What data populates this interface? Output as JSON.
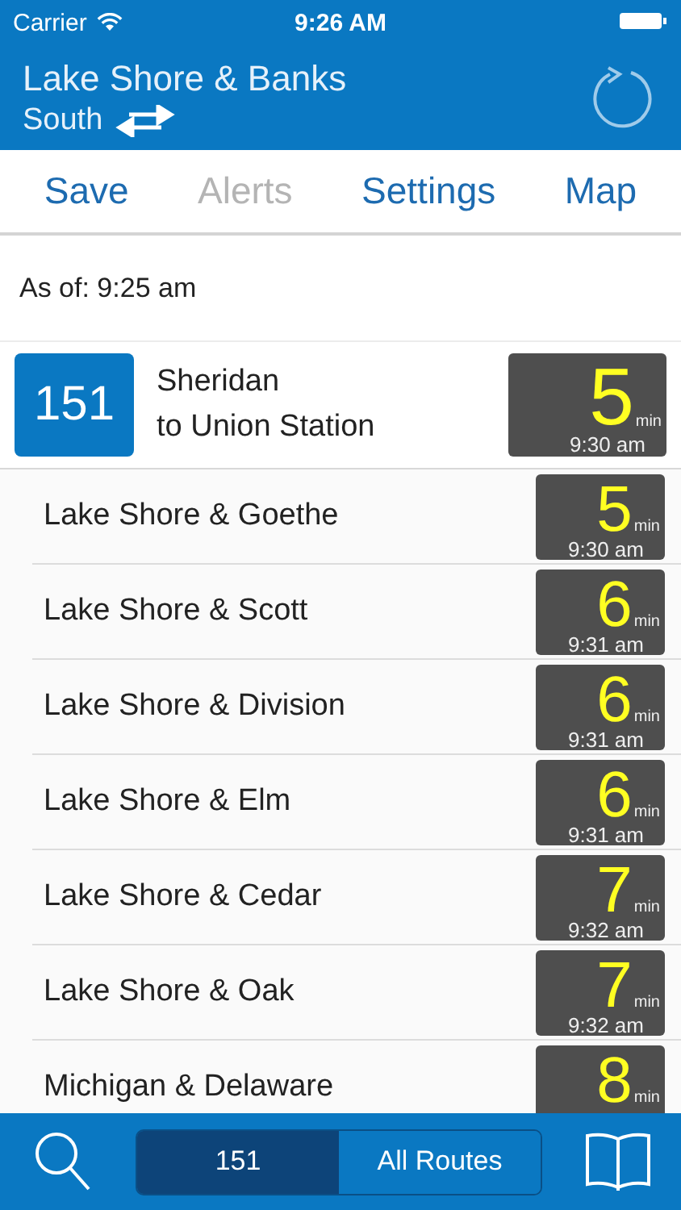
{
  "status_bar": {
    "carrier": "Carrier",
    "time": "9:26 AM"
  },
  "header": {
    "title": "Lake Shore & Banks",
    "direction": "South"
  },
  "actions": [
    {
      "label": "Save",
      "disabled": false
    },
    {
      "label": "Alerts",
      "disabled": true
    },
    {
      "label": "Settings",
      "disabled": false
    },
    {
      "label": "Map",
      "disabled": false
    }
  ],
  "as_of": "As of: 9:25 am",
  "route": {
    "number": "151",
    "name": "Sheridan",
    "destination": "to Union Station",
    "minutes": "5",
    "unit": "min",
    "time": "9:30 am"
  },
  "stops": [
    {
      "name": "Lake Shore & Goethe",
      "minutes": "5",
      "unit": "min",
      "time": "9:30 am"
    },
    {
      "name": "Lake Shore & Scott",
      "minutes": "6",
      "unit": "min",
      "time": "9:31 am"
    },
    {
      "name": "Lake Shore & Division",
      "minutes": "6",
      "unit": "min",
      "time": "9:31 am"
    },
    {
      "name": "Lake Shore & Elm",
      "minutes": "6",
      "unit": "min",
      "time": "9:31 am"
    },
    {
      "name": "Lake Shore & Cedar",
      "minutes": "7",
      "unit": "min",
      "time": "9:32 am"
    },
    {
      "name": "Lake Shore & Oak",
      "minutes": "7",
      "unit": "min",
      "time": "9:32 am"
    },
    {
      "name": "Michigan & Delaware",
      "minutes": "8",
      "unit": "min"
    }
  ],
  "segments": [
    {
      "label": "151",
      "selected": true
    },
    {
      "label": "All Routes",
      "selected": false
    }
  ]
}
